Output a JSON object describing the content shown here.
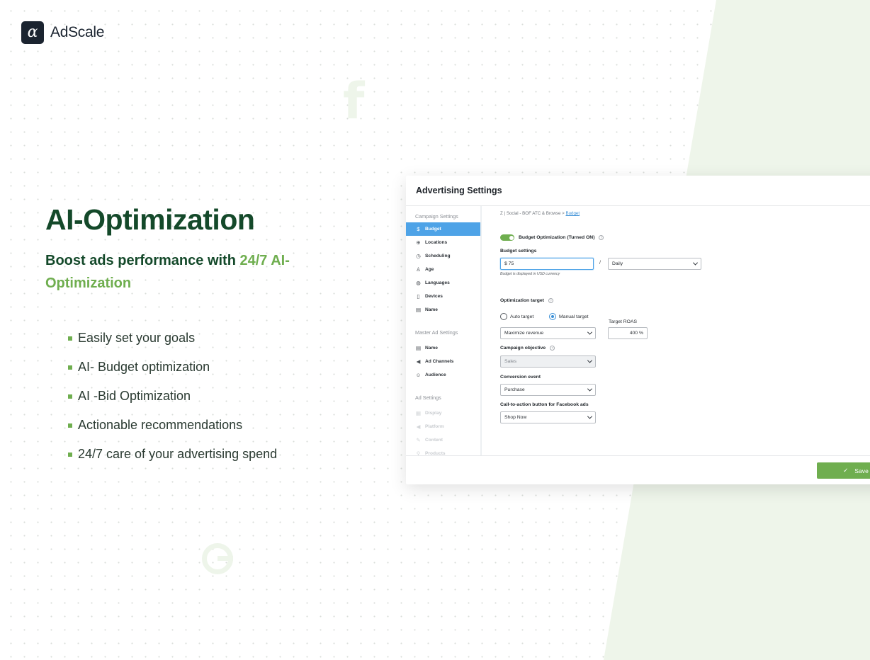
{
  "brand": {
    "logo_glyph": "α",
    "name": "AdScale"
  },
  "hero": {
    "title": "AI-Optimization",
    "subtitle_main": "Boost ads performance with ",
    "subtitle_highlight": "24/7 AI-Optimization"
  },
  "features": [
    "Easily set your goals",
    "AI- Budget optimization",
    "AI -Bid Optimization",
    "Actionable recommendations",
    "24/7 care of your advertising spend"
  ],
  "colors": {
    "accent_green": "#6fae4f",
    "dark_green": "#14492a",
    "active_blue": "#4ea3e7"
  },
  "panel": {
    "title": "Advertising Settings",
    "sidebar": {
      "sections": [
        {
          "heading": "Campaign Settings",
          "items": [
            {
              "label": "Budget",
              "icon": "dollar-circle-icon",
              "glyph": "$",
              "active": true
            },
            {
              "label": "Locations",
              "icon": "globe-icon",
              "glyph": "⊕"
            },
            {
              "label": "Scheduling",
              "icon": "clock-icon",
              "glyph": "◷"
            },
            {
              "label": "Age",
              "icon": "person-icon",
              "glyph": "♙"
            },
            {
              "label": "Languages",
              "icon": "globe-icon",
              "glyph": "◍"
            },
            {
              "label": "Devices",
              "icon": "phone-icon",
              "glyph": "▯"
            },
            {
              "label": "Name",
              "icon": "clipboard-icon",
              "glyph": "▤"
            }
          ]
        },
        {
          "heading": "Master Ad Settings",
          "items": [
            {
              "label": "Name",
              "icon": "clipboard-icon",
              "glyph": "▤"
            },
            {
              "label": "Ad Channels",
              "icon": "megaphone-icon",
              "glyph": "◀"
            },
            {
              "label": "Audience",
              "icon": "people-icon",
              "glyph": "☺"
            }
          ]
        },
        {
          "heading": "Ad Settings",
          "items": [
            {
              "label": "Display",
              "icon": "display-icon",
              "glyph": "▦",
              "faded": true
            },
            {
              "label": "Platform",
              "icon": "megaphone-icon",
              "glyph": "◀",
              "faded": true
            },
            {
              "label": "Content",
              "icon": "content-icon",
              "glyph": "✎",
              "faded": true
            },
            {
              "label": "Products",
              "icon": "search-icon",
              "glyph": "⚲",
              "faded": true
            }
          ]
        }
      ]
    },
    "breadcrumb": {
      "path": "Z | Social - BOF ATC & Browse",
      "separator": ">",
      "current": "Budget"
    },
    "budget_optimization_label": "Budget Optimization (Turned ON)",
    "budget_settings": {
      "label": "Budget settings",
      "amount": "$ 75",
      "separator": "/",
      "period": "Daily",
      "note": "Budget is displayed in USD currency"
    },
    "optimization_target": {
      "label": "Optimization target",
      "options": [
        "Auto target",
        "Manual target"
      ],
      "selected": "Manual target",
      "strategy": "Maximize revenue",
      "target_roas_label": "Target ROAS",
      "target_roas_value": "400 %"
    },
    "campaign_objective": {
      "label": "Campaign objective",
      "value": "Sales"
    },
    "conversion_event": {
      "label": "Conversion event",
      "value": "Purchase"
    },
    "cta": {
      "label": "Call-to-action button for Facebook ads",
      "value": "Shop Now"
    },
    "save_label": "Save"
  }
}
